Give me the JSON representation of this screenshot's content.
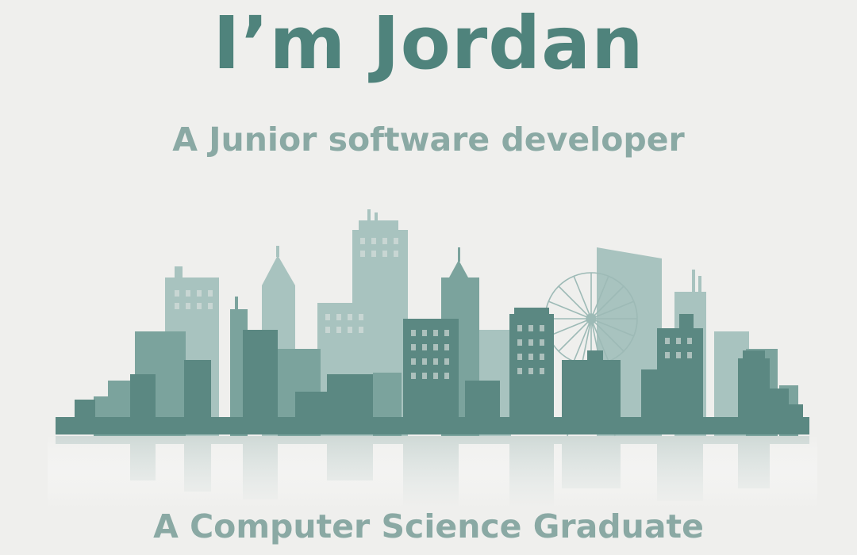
{
  "header": {
    "title": "I’m Jordan",
    "subtitle": "A Junior software developer"
  },
  "footer": {
    "tagline": "A Computer Science Graduate"
  },
  "colors": {
    "background": "#efefed",
    "title": "#4f837c",
    "subtitle": "#8aa9a4",
    "dark_building": "#5b8882",
    "mid_building": "#7ba39d",
    "light_building": "#a8c3bf"
  },
  "illustration": {
    "icon": "city-skyline-icon",
    "features": [
      "ferris-wheel-icon",
      "reflection"
    ]
  }
}
